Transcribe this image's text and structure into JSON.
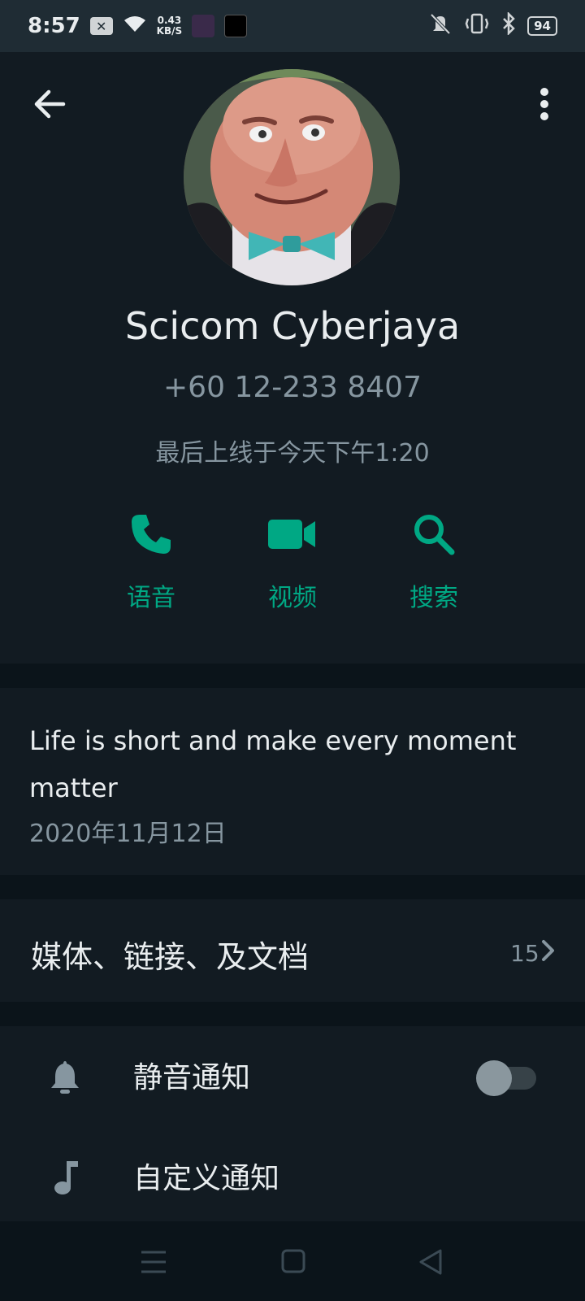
{
  "status_bar": {
    "time": "8:57",
    "network_speed_value": "0.43",
    "network_speed_unit": "KB/S",
    "battery": "94"
  },
  "contact": {
    "name": "Scicom Cyberjaya",
    "phone": "+60 12-233 8407",
    "last_seen": "最后上线于今天下午1:20"
  },
  "actions": [
    {
      "label": "语音",
      "icon": "phone-icon"
    },
    {
      "label": "视频",
      "icon": "video-icon"
    },
    {
      "label": "搜索",
      "icon": "search-icon"
    }
  ],
  "about": {
    "text": "Life is short and make every moment matter",
    "date": "2020年11月12日"
  },
  "media": {
    "title": "媒体、链接、及文档",
    "count": "15"
  },
  "settings": {
    "mute_label": "静音通知",
    "mute_enabled": false,
    "custom_label": "自定义通知"
  },
  "colors": {
    "accent": "#00a884",
    "background": "#0b141a",
    "panel": "#121b22",
    "secondary_text": "#8696a0"
  }
}
